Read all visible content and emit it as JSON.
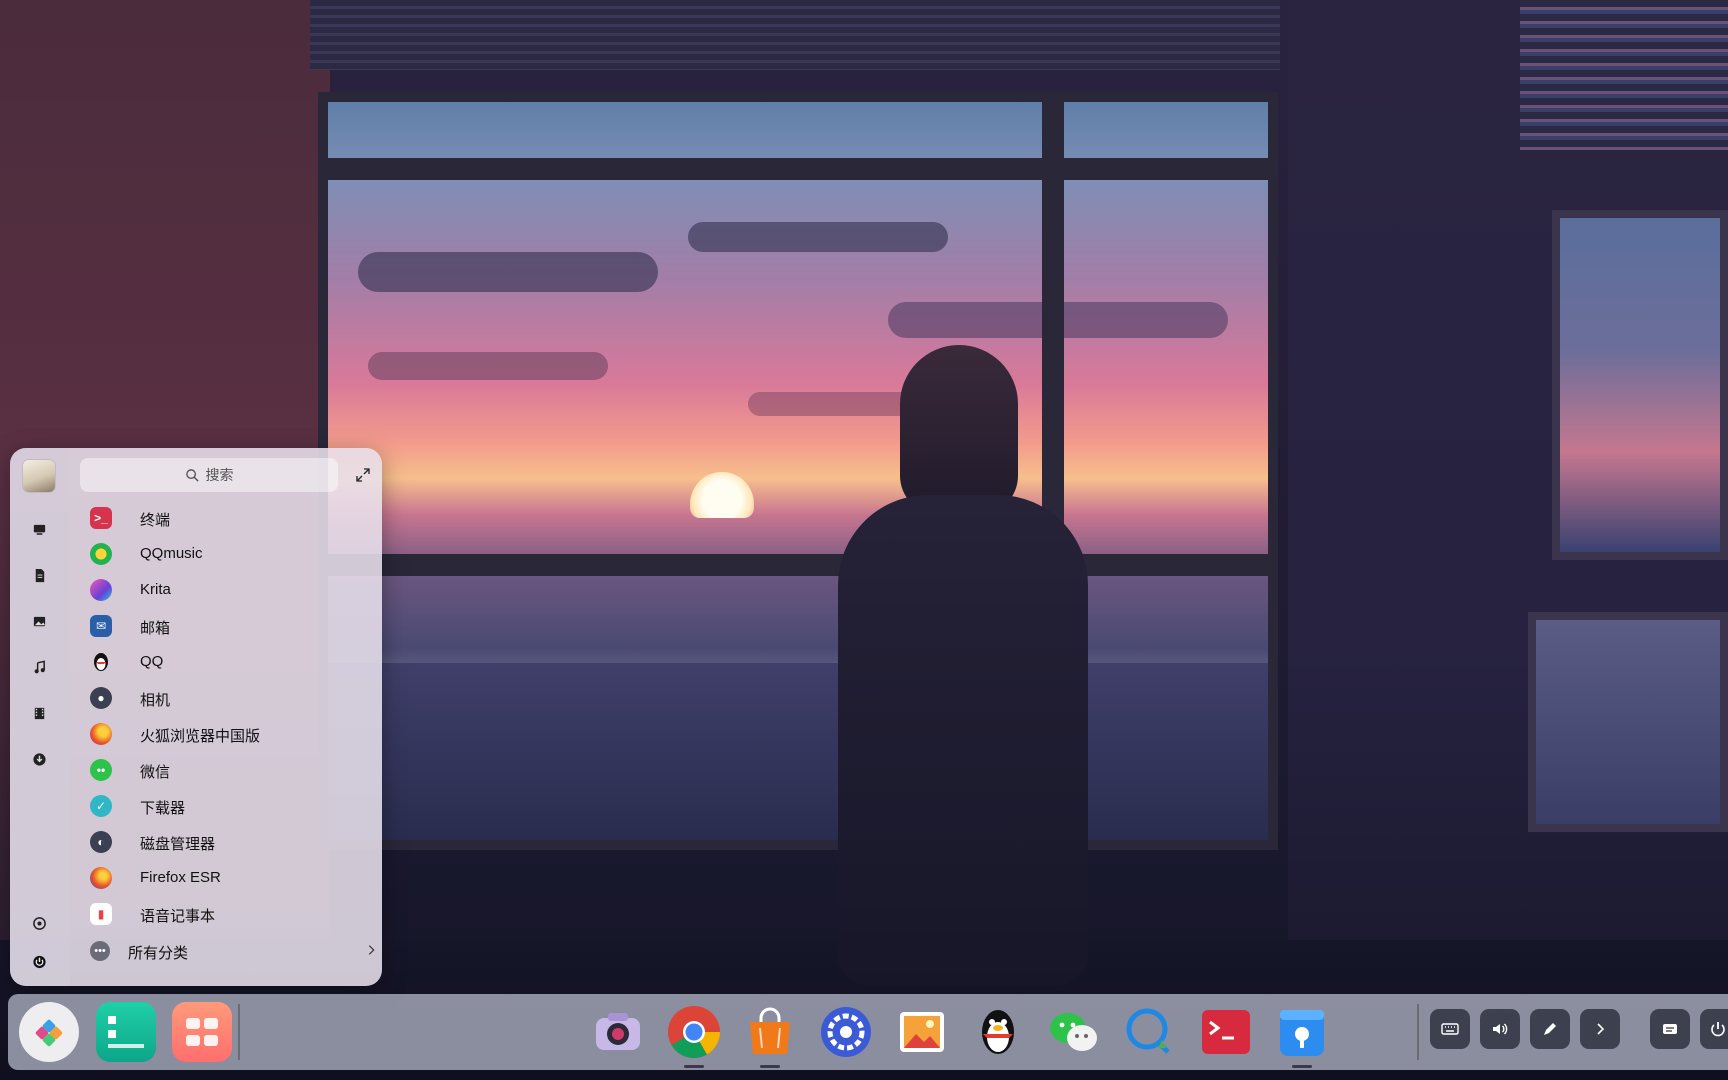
{
  "launcher": {
    "search_placeholder": "搜索",
    "apps": [
      {
        "label": "终端",
        "icon": "terminal-icon",
        "color": "#d6334c"
      },
      {
        "label": "QQmusic",
        "icon": "qqmusic-icon",
        "color": "#22b34e"
      },
      {
        "label": "Krita",
        "icon": "krita-icon",
        "color": "#6a3fd6"
      },
      {
        "label": "邮箱",
        "icon": "mail-icon",
        "color": "#2a5fa8"
      },
      {
        "label": "QQ",
        "icon": "qq-penguin-icon",
        "color": "#111111"
      },
      {
        "label": "相机",
        "icon": "camera-icon",
        "color": "#3a3f52"
      },
      {
        "label": "火狐浏览器中国版",
        "icon": "firefox-icon",
        "color": "#e8552a"
      },
      {
        "label": "微信",
        "icon": "wechat-icon",
        "color": "#2dc24a"
      },
      {
        "label": "下载器",
        "icon": "downloader-icon",
        "color": "#2fb6c7"
      },
      {
        "label": "磁盘管理器",
        "icon": "disk-manager-icon",
        "color": "#3a3f52"
      },
      {
        "label": "Firefox ESR",
        "icon": "firefox-esr-icon",
        "color": "#e8552a"
      },
      {
        "label": "语音记事本",
        "icon": "voice-notes-icon",
        "color": "#e64545"
      }
    ],
    "all_categories_label": "所有分类",
    "side_categories": [
      "computer-icon",
      "document-icon",
      "picture-icon",
      "music-icon",
      "video-icon",
      "download-icon"
    ],
    "side_bottom": [
      "settings-icon",
      "power-icon"
    ]
  },
  "dock": {
    "left_apps": [
      "launcher-icon",
      "multitask-view-icon",
      "file-manager-icon"
    ],
    "center_apps": [
      {
        "icon": "camera-icon",
        "running": false
      },
      {
        "icon": "chrome-icon",
        "running": true
      },
      {
        "icon": "app-store-icon",
        "running": true
      },
      {
        "icon": "control-center-icon",
        "running": false
      },
      {
        "icon": "image-viewer-icon",
        "running": false
      },
      {
        "icon": "qq-penguin-icon",
        "running": false
      },
      {
        "icon": "wechat-icon",
        "running": false
      },
      {
        "icon": "chat-client-icon",
        "running": false
      },
      {
        "icon": "terminal-icon",
        "running": false
      },
      {
        "icon": "screen-capture-icon",
        "running": true
      }
    ],
    "tray": [
      "keyboard-icon",
      "volume-icon",
      "pen-icon",
      "chevron-right-icon",
      "input-method-icon",
      "power-icon"
    ]
  }
}
